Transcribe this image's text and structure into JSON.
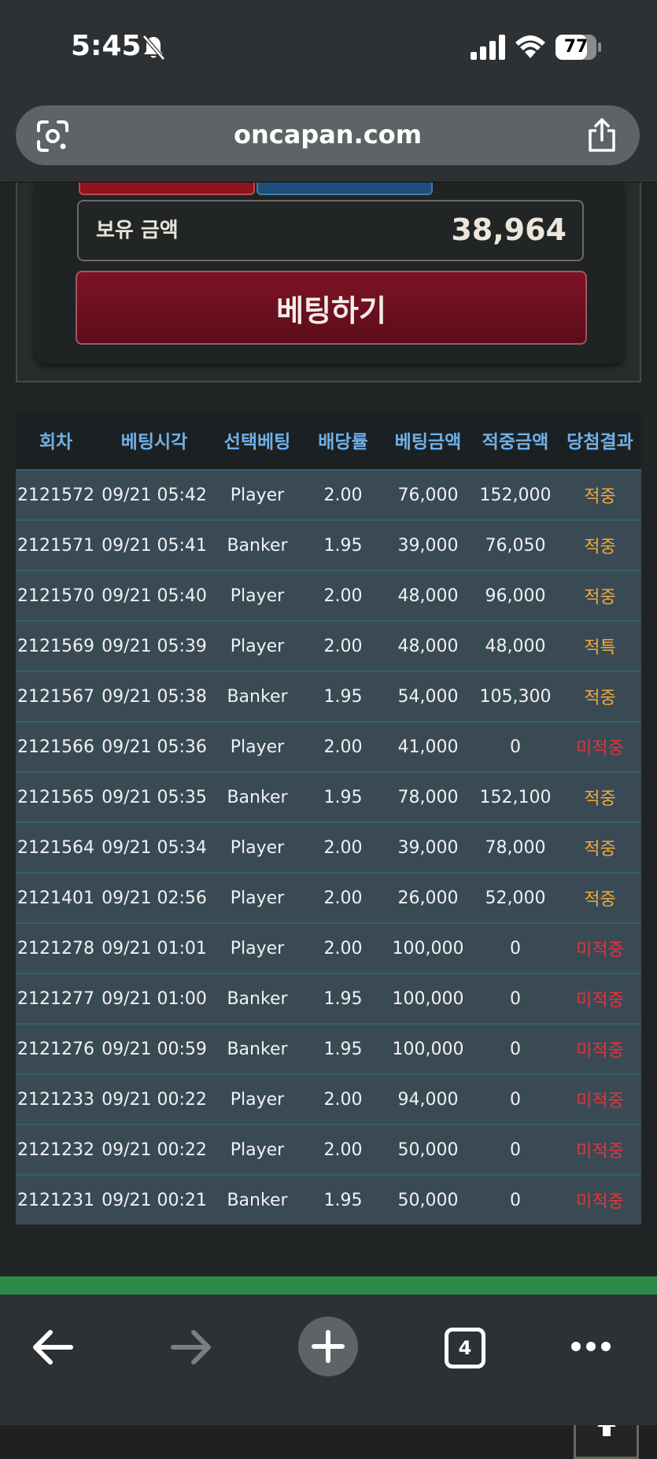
{
  "status": {
    "time": "5:45",
    "battery": "77"
  },
  "browser": {
    "url": "oncapan.com",
    "tab_count": "4"
  },
  "panel": {
    "balance_label": "보유 금액",
    "balance_value": "38,964",
    "bet_button": "베팅하기"
  },
  "table": {
    "headers": [
      "회차",
      "베팅시각",
      "선택베팅",
      "배당률",
      "베팅금액",
      "적중금액",
      "당첨결과"
    ],
    "rows": [
      [
        "2121572",
        "09/21 05:42",
        "Player",
        "2.00",
        "76,000",
        "152,000",
        "적중"
      ],
      [
        "2121571",
        "09/21 05:41",
        "Banker",
        "1.95",
        "39,000",
        "76,050",
        "적중"
      ],
      [
        "2121570",
        "09/21 05:40",
        "Player",
        "2.00",
        "48,000",
        "96,000",
        "적중"
      ],
      [
        "2121569",
        "09/21 05:39",
        "Player",
        "2.00",
        "48,000",
        "48,000",
        "적특"
      ],
      [
        "2121567",
        "09/21 05:38",
        "Banker",
        "1.95",
        "54,000",
        "105,300",
        "적중"
      ],
      [
        "2121566",
        "09/21 05:36",
        "Player",
        "2.00",
        "41,000",
        "0",
        "미적중"
      ],
      [
        "2121565",
        "09/21 05:35",
        "Banker",
        "1.95",
        "78,000",
        "152,100",
        "적중"
      ],
      [
        "2121564",
        "09/21 05:34",
        "Player",
        "2.00",
        "39,000",
        "78,000",
        "적중"
      ],
      [
        "2121401",
        "09/21 02:56",
        "Player",
        "2.00",
        "26,000",
        "52,000",
        "적중"
      ],
      [
        "2121278",
        "09/21 01:01",
        "Player",
        "2.00",
        "100,000",
        "0",
        "미적중"
      ],
      [
        "2121277",
        "09/21 01:00",
        "Banker",
        "1.95",
        "100,000",
        "0",
        "미적중"
      ],
      [
        "2121276",
        "09/21 00:59",
        "Banker",
        "1.95",
        "100,000",
        "0",
        "미적중"
      ],
      [
        "2121233",
        "09/21 00:22",
        "Player",
        "2.00",
        "94,000",
        "0",
        "미적중"
      ],
      [
        "2121232",
        "09/21 00:22",
        "Player",
        "2.00",
        "50,000",
        "0",
        "미적중"
      ],
      [
        "2121231",
        "09/21 00:21",
        "Banker",
        "1.95",
        "50,000",
        "0",
        "미적중"
      ]
    ],
    "result_colors": {
      "win": "#f0a93a",
      "lose": "#e2343b"
    }
  },
  "icons": {
    "status": [
      "bell-slash-icon",
      "cellular-signal-icon",
      "wifi-icon",
      "battery-icon"
    ],
    "browser": [
      "google-lens-icon",
      "share-icon"
    ],
    "toolbar": [
      "back-arrow-icon",
      "forward-arrow-icon",
      "new-tab-plus-icon",
      "tab-switcher-icon",
      "more-icon"
    ],
    "page": [
      "scroll-top-arrow-icon"
    ]
  }
}
